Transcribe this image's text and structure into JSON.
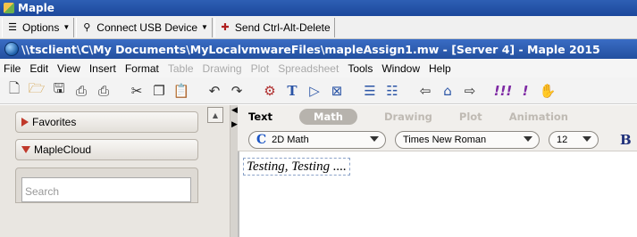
{
  "outer_window": {
    "title": "Maple"
  },
  "remote_toolbar": {
    "options_label": "Options",
    "usb_label": "Connect USB Device",
    "cad_label": "Send Ctrl-Alt-Delete"
  },
  "maple_window": {
    "title": "\\\\tsclient\\C\\My Documents\\MyLocalvmwareFiles\\mapleAssign1.mw - [Server 4] - Maple 2015"
  },
  "menubar": {
    "items": [
      {
        "label": "File",
        "enabled": true
      },
      {
        "label": "Edit",
        "enabled": true
      },
      {
        "label": "View",
        "enabled": true
      },
      {
        "label": "Insert",
        "enabled": true
      },
      {
        "label": "Format",
        "enabled": true
      },
      {
        "label": "Table",
        "enabled": false
      },
      {
        "label": "Drawing",
        "enabled": false
      },
      {
        "label": "Plot",
        "enabled": false
      },
      {
        "label": "Spreadsheet",
        "enabled": false
      },
      {
        "label": "Tools",
        "enabled": true
      },
      {
        "label": "Window",
        "enabled": true
      },
      {
        "label": "Help",
        "enabled": true
      }
    ]
  },
  "toolbar": {
    "icons": [
      "new-document-icon",
      "open-icon",
      "save-icon",
      "print-icon",
      "print-preview-icon",
      "cut-icon",
      "copy-icon",
      "paste-icon",
      "undo-icon",
      "redo-icon",
      "math-text-icon",
      "text-mode-icon",
      "execution-group-icon",
      "sum-icon",
      "expand-section-icon",
      "collapse-section-icon",
      "back-icon",
      "home-icon",
      "forward-icon",
      "execute-all-icon",
      "execute-icon",
      "interrupt-icon"
    ]
  },
  "palettes": {
    "favorites_label": "Favorites",
    "maplecloud_label": "MapleCloud",
    "search_placeholder": "Search"
  },
  "context_bar": {
    "modes": [
      "Text",
      "Math",
      "Drawing",
      "Plot",
      "Animation"
    ],
    "active_mode": "Math",
    "math_style": "2D Math",
    "font": "Times New Roman",
    "size": "12",
    "bold_label": "B"
  },
  "document": {
    "input_text": "Testing, Testing ...."
  }
}
